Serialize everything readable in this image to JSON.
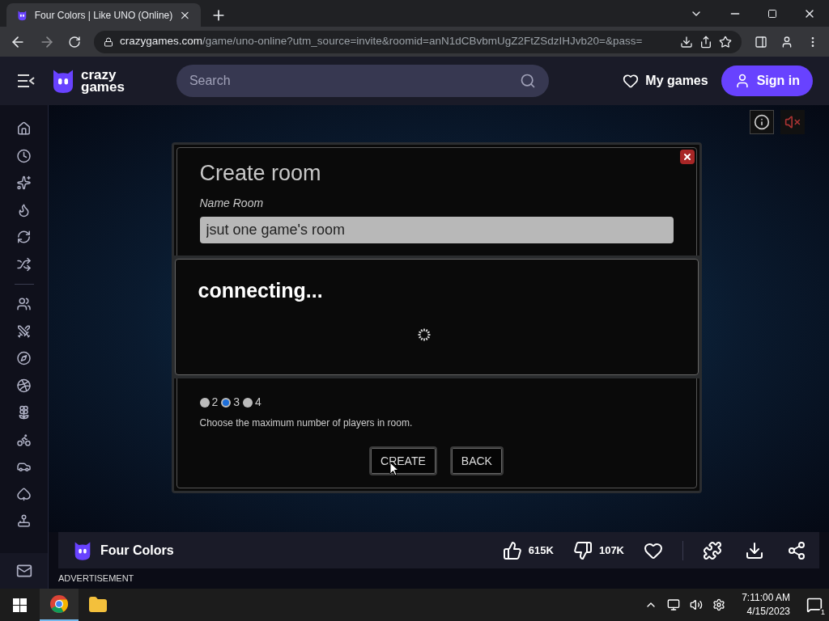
{
  "browser": {
    "tab_title": "Four Colors | Like UNO (Online)",
    "url_domain": "crazygames.com",
    "url_path": "/game/uno-online?utm_source=invite&roomid=anN1dCBvbmUgZ2FtZSdzIHJvb20=&pass="
  },
  "header": {
    "logo_top": "crazy",
    "logo_bottom": "games",
    "search_placeholder": "Search",
    "my_games": "My games",
    "sign_in": "Sign in"
  },
  "dialog": {
    "title": "Create room",
    "name_label": "Name Room",
    "name_value": "jsut one game's room",
    "options": [
      {
        "label": "2",
        "selected": false
      },
      {
        "label": "3",
        "selected": true
      },
      {
        "label": "4",
        "selected": false
      }
    ],
    "hint": "Choose the maximum number of players in room.",
    "buttons": [
      "CREATE",
      "BACK"
    ]
  },
  "overlay": {
    "message": "connecting..."
  },
  "game_bar": {
    "title": "Four Colors",
    "likes": "615K",
    "dislikes": "107K"
  },
  "ad_label": "ADVERTISEMENT",
  "taskbar": {
    "time": "7:11:00 AM",
    "date": "4/15/2023",
    "notifications": "1"
  }
}
